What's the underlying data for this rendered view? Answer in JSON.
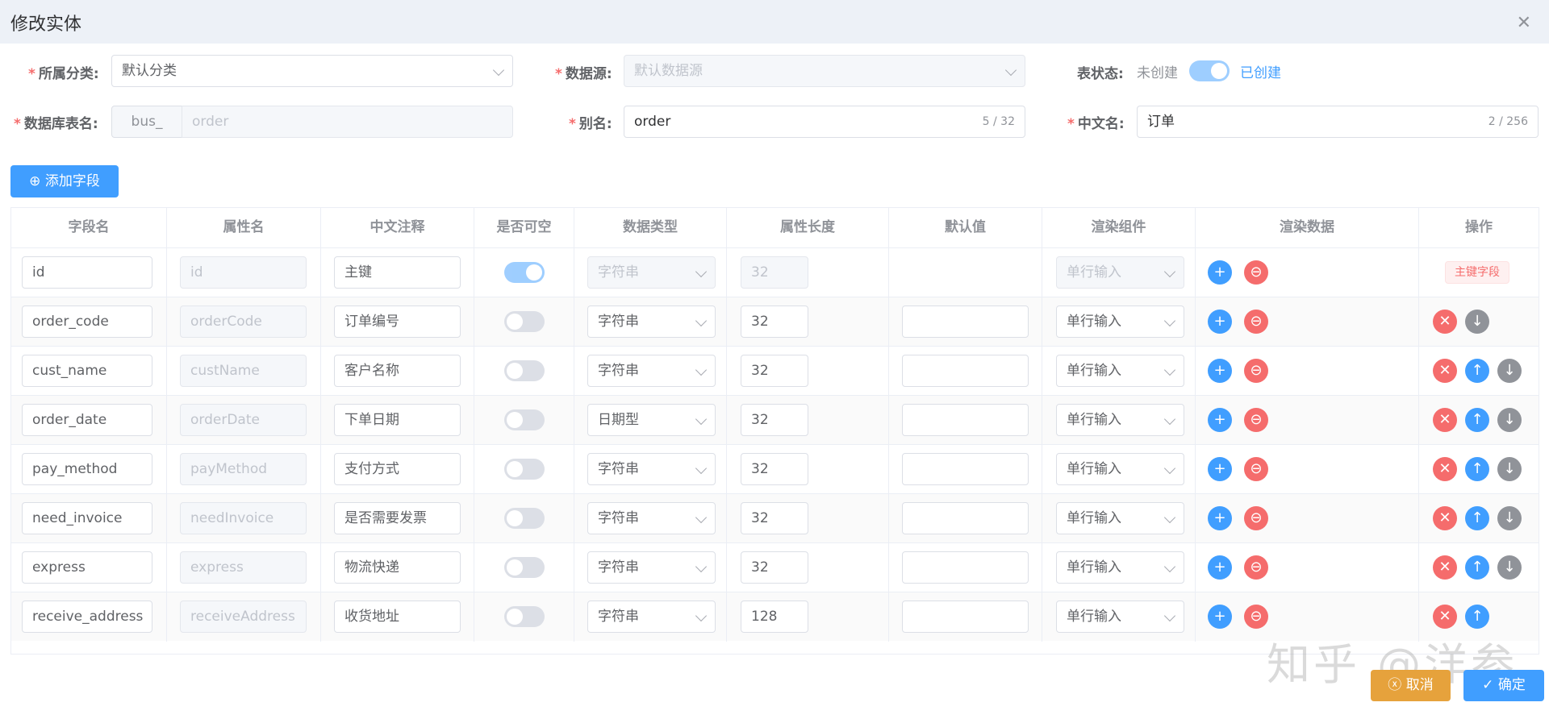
{
  "dialog": {
    "title": "修改实体",
    "close_icon": "close-icon"
  },
  "form": {
    "category_label": "所属分类:",
    "category_value": "默认分类",
    "datasource_label": "数据源:",
    "datasource_value": "默认数据源",
    "table_status_label": "表状态:",
    "status_off": "未创建",
    "status_on": "已创建",
    "table_name_label": "数据库表名:",
    "table_prefix": "bus_",
    "table_name_value": "order",
    "alias_label": "别名:",
    "alias_value": "order",
    "alias_count": "5 / 32",
    "cn_name_label": "中文名:",
    "cn_name_value": "订单",
    "cn_name_count": "2 / 256"
  },
  "add_field_label": "添加字段",
  "columns": [
    "字段名",
    "属性名",
    "中文注释",
    "是否可空",
    "数据类型",
    "属性长度",
    "默认值",
    "渲染组件",
    "渲染数据",
    "操作"
  ],
  "rows": [
    {
      "field": "id",
      "prop": "id",
      "comment": "主键",
      "nullable": true,
      "type": "字符串",
      "length": "32",
      "component": "单行输入",
      "pk_tag": "主键字段"
    },
    {
      "field": "order_code",
      "prop": "orderCode",
      "comment": "订单编号",
      "nullable": false,
      "type": "字符串",
      "length": "32",
      "component": "单行输入"
    },
    {
      "field": "cust_name",
      "prop": "custName",
      "comment": "客户名称",
      "nullable": false,
      "type": "字符串",
      "length": "32",
      "component": "单行输入"
    },
    {
      "field": "order_date",
      "prop": "orderDate",
      "comment": "下单日期",
      "nullable": false,
      "type": "日期型",
      "length": "32",
      "component": "单行输入"
    },
    {
      "field": "pay_method",
      "prop": "payMethod",
      "comment": "支付方式",
      "nullable": false,
      "type": "字符串",
      "length": "32",
      "component": "单行输入"
    },
    {
      "field": "need_invoice",
      "prop": "needInvoice",
      "comment": "是否需要发票",
      "nullable": false,
      "type": "字符串",
      "length": "32",
      "component": "单行输入"
    },
    {
      "field": "express",
      "prop": "express",
      "comment": "物流快递",
      "nullable": false,
      "type": "字符串",
      "length": "32",
      "component": "单行输入"
    },
    {
      "field": "receive_address",
      "prop": "receiveAddress",
      "comment": "收货地址",
      "nullable": false,
      "type": "字符串",
      "length": "128",
      "component": "单行输入"
    }
  ],
  "footer": {
    "cancel_label": "取消",
    "ok_label": "确定"
  },
  "watermark": "知乎 @洋参",
  "colors": {
    "primary": "#409eff",
    "danger": "#f56c6c",
    "warning": "#e6a23c",
    "info": "#909399"
  }
}
